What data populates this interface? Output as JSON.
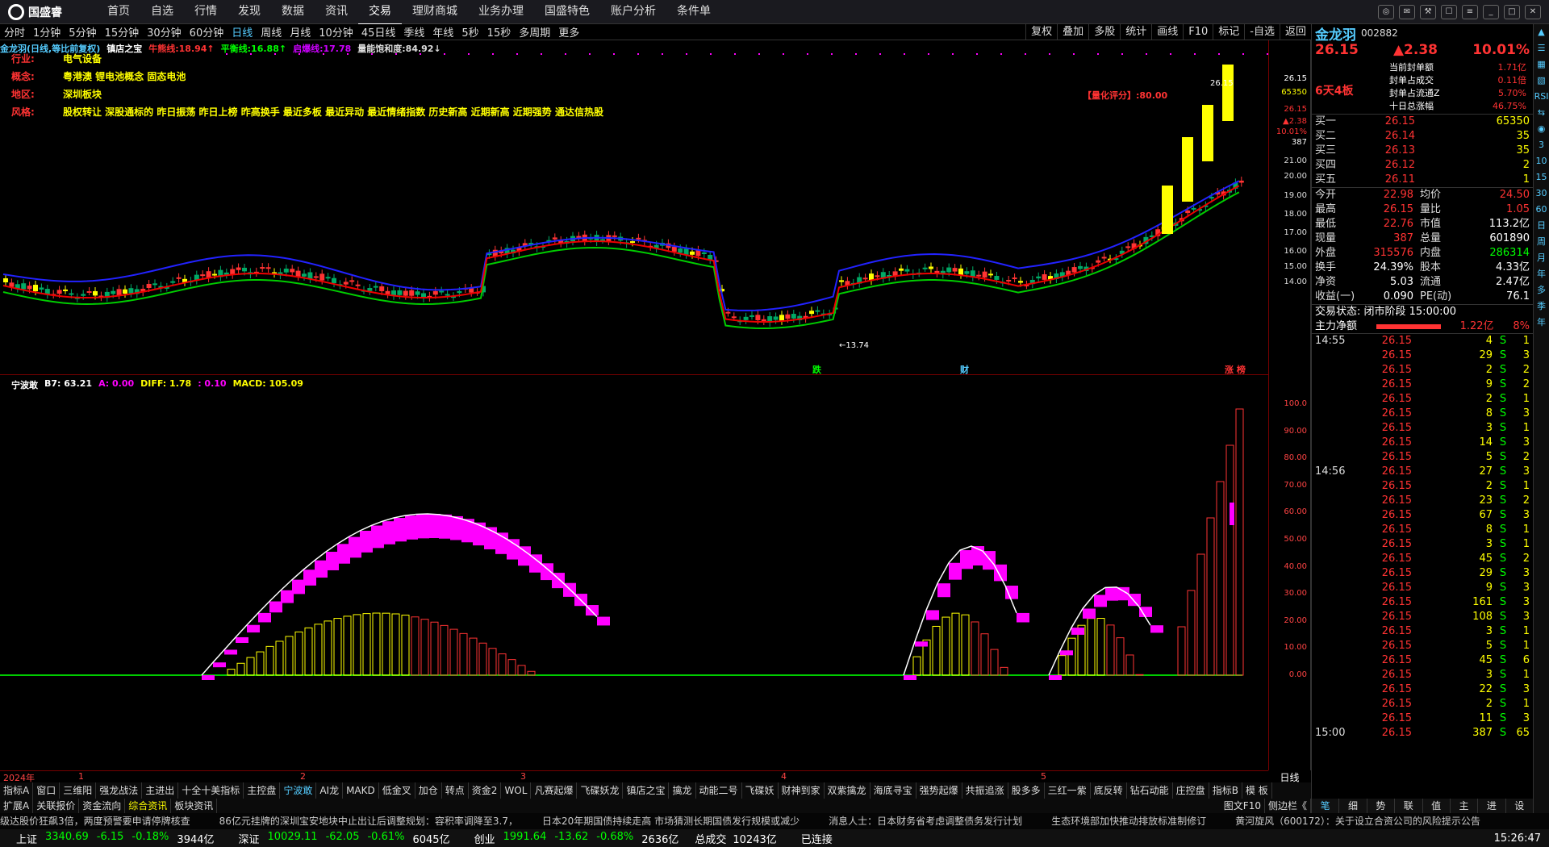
{
  "app": {
    "brand": "国盛睿",
    "menu": [
      "首页",
      "自选",
      "行情",
      "发现",
      "数据",
      "资讯",
      "交易",
      "理财商城",
      "业务办理",
      "国盛特色",
      "账户分析",
      "条件单"
    ],
    "active_menu": "交易"
  },
  "periods": {
    "items": [
      "分时",
      "1分钟",
      "5分钟",
      "15分钟",
      "30分钟",
      "60分钟",
      "日线",
      "周线",
      "月线",
      "10分钟",
      "45日线",
      "季线",
      "年线",
      "5秒",
      "15秒",
      "多周期",
      "更多"
    ],
    "active": "日线"
  },
  "tools": [
    "复权",
    "叠加",
    "多股",
    "统计",
    "画线",
    "F10",
    "标记",
    "-自选",
    "返回"
  ],
  "chart": {
    "stock_info": "金龙羽(日线,等比前复权)",
    "indicator_name": "镇店之宝",
    "lines": [
      {
        "label": "牛熊线:18.94↑",
        "color": "#f33"
      },
      {
        "label": "平衡线:16.88↑",
        "color": "#0f0"
      },
      {
        "label": "启爆线:17.78",
        "color": "#c0f"
      },
      {
        "label": "量能饱和度:84.92↓",
        "color": "#ddd"
      }
    ],
    "fundamentals": [
      {
        "k": "行业:",
        "v": "电气设备"
      },
      {
        "k": "概念:",
        "v": "粤港澳 锂电池概念 固态电池"
      },
      {
        "k": "地区:",
        "v": "深圳板块"
      },
      {
        "k": "风格:",
        "v": "股权转让 深股通标的 昨日振荡 昨日上榜 昨高换手 最近多板 最近异动 最近情绪指数 历史新高 近期新高 近期强势 通达信热股"
      }
    ],
    "quant_score": "【量化评分】:80.00",
    "top_price": "26.15",
    "low_price": "←13.74",
    "upper_axis": [
      "26.15",
      "65350",
      "26.15",
      "▲2.38",
      "10.01%",
      "387",
      "21.00",
      "20.00",
      "19.00",
      "18.00",
      "17.00",
      "16.00",
      "15.00",
      "14.00"
    ],
    "event_labels": [
      "跌",
      "财",
      "涨 榜"
    ]
  },
  "indicator": {
    "name": "宁波敢",
    "values": [
      {
        "label": "B7: 63.21",
        "color": "#fff"
      },
      {
        "label": "A: 0.00",
        "color": "#f0f"
      },
      {
        "label": "DIFF: 1.78",
        "color": "#ff0"
      },
      {
        "label": ": 0.10",
        "color": "#f0f"
      },
      {
        "label": "MACD: 105.09",
        "color": "#ff0"
      }
    ],
    "axis": [
      "100.0",
      "90.00",
      "80.00",
      "70.00",
      "60.00",
      "50.00",
      "40.00",
      "30.00",
      "20.00",
      "10.00",
      "0.00"
    ]
  },
  "time_axis": {
    "labels": [
      "2024年",
      "1",
      "2",
      "3",
      "4",
      "5"
    ],
    "period_label": "日线"
  },
  "tabs": [
    "指标A",
    "窗口",
    "三维阳",
    "强龙战法",
    "主进出",
    "十全十美指标",
    "主控盘",
    "宁波敢",
    "AI龙",
    "MAKD",
    "低金叉",
    "加仓",
    "转点",
    "资金2",
    "WOL",
    "凡赛起爆",
    "飞碟妖龙",
    "镇店之宝",
    "擒龙",
    "动能二号",
    "飞碟妖",
    "财神到家",
    "双紫擒龙",
    "海底寻宝",
    "强势起爆",
    "共振追涨",
    "股多多",
    "三红一紫",
    "底反转",
    "钻石动能",
    "庄控盘",
    "指标B",
    "模 板"
  ],
  "active_tab": "宁波敢",
  "tabs2": [
    "扩展A",
    "关联报价",
    "资金流向",
    "综合资讯",
    "板块资讯"
  ],
  "active_tab2": "综合资讯",
  "tabs2_right": [
    "图文F10",
    "侧边栏《"
  ],
  "news": "级达股价狂飙3倍，两度预警要申请停牌核查　　　86亿元挂牌的深圳宝安地块中止出让后调整规划：容积率调降至3.7，　　　日本20年期国债持续走高 市场猜测长期国债发行规模或减少　　　消息人士：日本财务省考虑调整债务发行计划　　　生态环境部加快推动排放标准制修订　　　黄河旋风（600172）：关于设立合资公司的风险提示公告",
  "status": {
    "indices": [
      {
        "name": "上证",
        "val": "3340.69",
        "chg": "-6.15",
        "pct": "-0.18%",
        "amt": "3944亿"
      },
      {
        "name": "深证",
        "val": "10029.11",
        "chg": "-62.05",
        "pct": "-0.61%",
        "amt": "6045亿"
      },
      {
        "name": "创业",
        "val": "1991.64",
        "chg": "-13.62",
        "pct": "-0.68%",
        "amt": "2636亿"
      }
    ],
    "total_label": "总成交",
    "total": "10243亿",
    "conn": "已连接",
    "time": "15:26:47"
  },
  "quote": {
    "name": "金龙羽",
    "code": "002882",
    "price": "26.15",
    "chg": "▲2.38",
    "pct": "10.01%",
    "board": "6天4板",
    "seal": [
      {
        "k": "当前封单额",
        "v": "1.71亿"
      },
      {
        "k": "封单占成交",
        "v": "0.11倍"
      },
      {
        "k": "封单占流通Z",
        "v": "5.70%"
      },
      {
        "k": "十日总涨幅",
        "v": "46.75%"
      }
    ],
    "bids": [
      {
        "l": "买一",
        "p": "26.15",
        "v": "65350"
      },
      {
        "l": "买二",
        "p": "26.14",
        "v": "35"
      },
      {
        "l": "买三",
        "p": "26.13",
        "v": "35"
      },
      {
        "l": "买四",
        "p": "26.12",
        "v": "2"
      },
      {
        "l": "买五",
        "p": "26.11",
        "v": "1"
      }
    ],
    "stats": [
      {
        "k1": "今开",
        "v1": "22.98",
        "k2": "均价",
        "v2": "24.50"
      },
      {
        "k1": "最高",
        "v1": "26.15",
        "k2": "量比",
        "v2": "1.05"
      },
      {
        "k1": "最低",
        "v1": "22.76",
        "k2": "市值",
        "v2": "113.2亿"
      },
      {
        "k1": "现量",
        "v1": "387",
        "k2": "总量",
        "v2": "601890"
      },
      {
        "k1": "外盘",
        "v1": "315576",
        "k2": "内盘",
        "v2": "286314"
      },
      {
        "k1": "换手",
        "v1": "24.39%",
        "k2": "股本",
        "v2": "4.33亿"
      },
      {
        "k1": "净资",
        "v1": "5.03",
        "k2": "流通",
        "v2": "2.47亿"
      },
      {
        "k1": "收益(一)",
        "v1": "0.090",
        "k2": "PE(动)",
        "v2": "76.1"
      }
    ],
    "trade_state": "交易状态: 闭市阶段 15:00:00",
    "main_flow_label": "主力净额",
    "main_flow": "1.22亿",
    "main_flow_pct": "8%",
    "ticks": [
      {
        "t": "14:55",
        "p": "26.15",
        "v": "4",
        "s": "S",
        "n": "1"
      },
      {
        "t": "",
        "p": "26.15",
        "v": "29",
        "s": "S",
        "n": "3"
      },
      {
        "t": "",
        "p": "26.15",
        "v": "2",
        "s": "S",
        "n": "2"
      },
      {
        "t": "",
        "p": "26.15",
        "v": "9",
        "s": "S",
        "n": "2"
      },
      {
        "t": "",
        "p": "26.15",
        "v": "2",
        "s": "S",
        "n": "1"
      },
      {
        "t": "",
        "p": "26.15",
        "v": "8",
        "s": "S",
        "n": "3"
      },
      {
        "t": "",
        "p": "26.15",
        "v": "3",
        "s": "S",
        "n": "1"
      },
      {
        "t": "",
        "p": "26.15",
        "v": "14",
        "s": "S",
        "n": "3"
      },
      {
        "t": "",
        "p": "26.15",
        "v": "5",
        "s": "S",
        "n": "2"
      },
      {
        "t": "14:56",
        "p": "26.15",
        "v": "27",
        "s": "S",
        "n": "3"
      },
      {
        "t": "",
        "p": "26.15",
        "v": "2",
        "s": "S",
        "n": "1"
      },
      {
        "t": "",
        "p": "26.15",
        "v": "23",
        "s": "S",
        "n": "2"
      },
      {
        "t": "",
        "p": "26.15",
        "v": "67",
        "s": "S",
        "n": "3"
      },
      {
        "t": "",
        "p": "26.15",
        "v": "8",
        "s": "S",
        "n": "1"
      },
      {
        "t": "",
        "p": "26.15",
        "v": "3",
        "s": "S",
        "n": "1"
      },
      {
        "t": "",
        "p": "26.15",
        "v": "45",
        "s": "S",
        "n": "2"
      },
      {
        "t": "",
        "p": "26.15",
        "v": "29",
        "s": "S",
        "n": "3"
      },
      {
        "t": "",
        "p": "26.15",
        "v": "9",
        "s": "S",
        "n": "3"
      },
      {
        "t": "",
        "p": "26.15",
        "v": "161",
        "s": "S",
        "n": "3"
      },
      {
        "t": "",
        "p": "26.15",
        "v": "108",
        "s": "S",
        "n": "3"
      },
      {
        "t": "",
        "p": "26.15",
        "v": "3",
        "s": "S",
        "n": "1"
      },
      {
        "t": "",
        "p": "26.15",
        "v": "5",
        "s": "S",
        "n": "1"
      },
      {
        "t": "",
        "p": "26.15",
        "v": "45",
        "s": "S",
        "n": "6"
      },
      {
        "t": "",
        "p": "26.15",
        "v": "3",
        "s": "S",
        "n": "1"
      },
      {
        "t": "",
        "p": "26.15",
        "v": "22",
        "s": "S",
        "n": "3"
      },
      {
        "t": "",
        "p": "26.15",
        "v": "2",
        "s": "S",
        "n": "1"
      },
      {
        "t": "",
        "p": "26.15",
        "v": "11",
        "s": "S",
        "n": "3"
      },
      {
        "t": "15:00",
        "p": "26.15",
        "v": "387",
        "s": "S",
        "n": "65"
      }
    ],
    "bottom_tabs": [
      "笔",
      "细",
      "势",
      "联",
      "值",
      "主",
      "进",
      "设"
    ],
    "active_bottom": "笔"
  },
  "sidestrip": [
    "▲",
    "☰",
    "▦",
    "▧",
    "RSI",
    "⇆",
    "◉",
    "3",
    "10",
    "15",
    "30",
    "60",
    "日",
    "周",
    "月",
    "年",
    "多",
    "季",
    "年"
  ]
}
